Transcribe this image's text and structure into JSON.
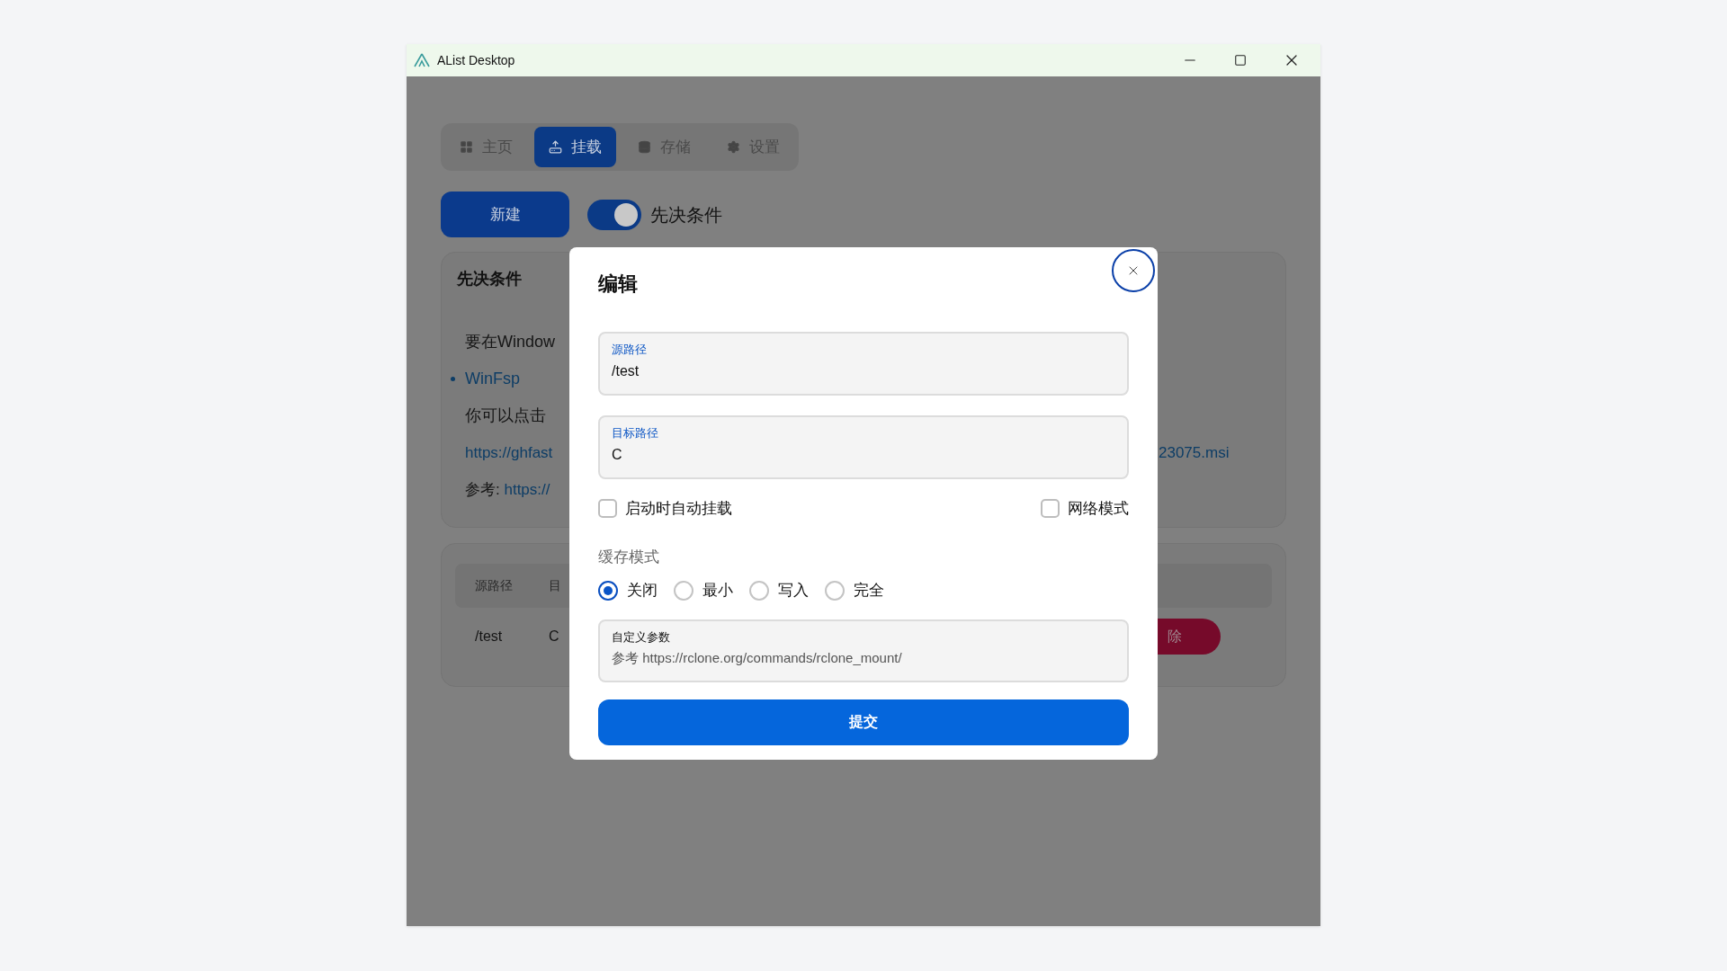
{
  "window": {
    "title": "AList Desktop"
  },
  "tabs": [
    {
      "label": "主页",
      "selected": false
    },
    {
      "label": "挂载",
      "selected": true
    },
    {
      "label": "存储",
      "selected": false
    },
    {
      "label": "设置",
      "selected": false
    }
  ],
  "toolbar": {
    "new_button": "新建",
    "toggle": {
      "label": "先决条件",
      "on": true
    }
  },
  "prerequisites_card": {
    "title": "先决条件",
    "lines": [
      {
        "kind": "text",
        "text": "要在Window"
      },
      {
        "kind": "bullet_link",
        "text": "WinFsp"
      },
      {
        "kind": "text",
        "text": "你可以点击"
      },
      {
        "kind": "link",
        "text": "https://ghfast",
        "trailing": "23075.msi"
      },
      {
        "kind": "reference",
        "prefix": "参考: ",
        "link": "https://"
      }
    ]
  },
  "mounts_table": {
    "columns": [
      "源路径",
      "目"
    ],
    "rows": [
      {
        "cells": [
          "/test",
          "C"
        ],
        "action": "除"
      }
    ]
  },
  "dialog": {
    "title": "编辑",
    "fields": [
      {
        "label": "源路径",
        "value": "/test"
      },
      {
        "label": "目标路径",
        "value": "C"
      }
    ],
    "checkboxes": [
      {
        "label": "启动时自动挂载",
        "checked": false
      },
      {
        "label": "网络模式",
        "checked": false
      }
    ],
    "cache_mode": {
      "label": "缓存模式",
      "options": [
        {
          "label": "关闭",
          "selected": true
        },
        {
          "label": "最小",
          "selected": false
        },
        {
          "label": "写入",
          "selected": false
        },
        {
          "label": "完全",
          "selected": false
        }
      ]
    },
    "custom_params": {
      "label": "自定义参数",
      "placeholder": "参考 https://rclone.org/commands/rclone_mount/"
    },
    "submit": "提交"
  }
}
